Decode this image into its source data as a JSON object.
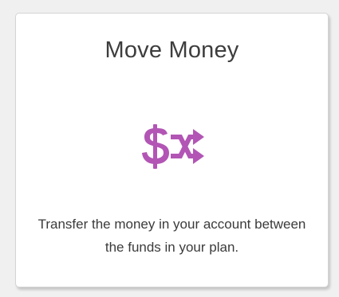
{
  "card": {
    "title": "Move Money",
    "icon": "dollar-shuffle-icon",
    "icon_color": "#b255b5",
    "description": "Transfer the money in your account between the funds in your plan."
  }
}
